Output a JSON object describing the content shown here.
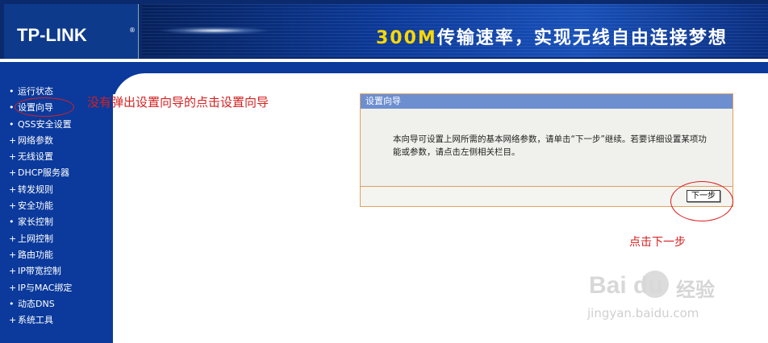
{
  "header": {
    "logo": "TP-LINK",
    "logo_mark": "®",
    "slogan_highlight": "300M",
    "slogan_rest": "传输速率，实现无线自由连接梦想"
  },
  "sidebar": {
    "items": [
      {
        "bullet": "•",
        "label": "运行状态"
      },
      {
        "bullet": "•",
        "label": "设置向导"
      },
      {
        "bullet": "•",
        "label": "QSS安全设置"
      },
      {
        "bullet": "+",
        "label": "网络参数"
      },
      {
        "bullet": "+",
        "label": "无线设置"
      },
      {
        "bullet": "+",
        "label": "DHCP服务器"
      },
      {
        "bullet": "+",
        "label": "转发规则"
      },
      {
        "bullet": "+",
        "label": "安全功能"
      },
      {
        "bullet": "•",
        "label": "家长控制"
      },
      {
        "bullet": "+",
        "label": "上网控制"
      },
      {
        "bullet": "+",
        "label": "路由功能"
      },
      {
        "bullet": "+",
        "label": "IP带宽控制"
      },
      {
        "bullet": "+",
        "label": "IP与MAC绑定"
      },
      {
        "bullet": "•",
        "label": "动态DNS"
      },
      {
        "bullet": "+",
        "label": "系统工具"
      }
    ]
  },
  "annotations": {
    "menu_hint": "没有弹出设置向导的点击设置向导",
    "next_hint": "点击下一步"
  },
  "wizard": {
    "title": "设置向导",
    "description": "本向导可设置上网所需的基本网络参数，请单击“下一步”继续。若要详细设置某项功能或参数，请点击左侧相关栏目。",
    "next_button": "下一步"
  },
  "watermark": {
    "logo": "Bai  du",
    "cn": "经验",
    "url": "jingyan.baidu.com"
  },
  "colors": {
    "sidebar_bg": "#0b3a9c",
    "panel_title_bg": "#6d8fd0",
    "annotation_red": "#d42020"
  }
}
